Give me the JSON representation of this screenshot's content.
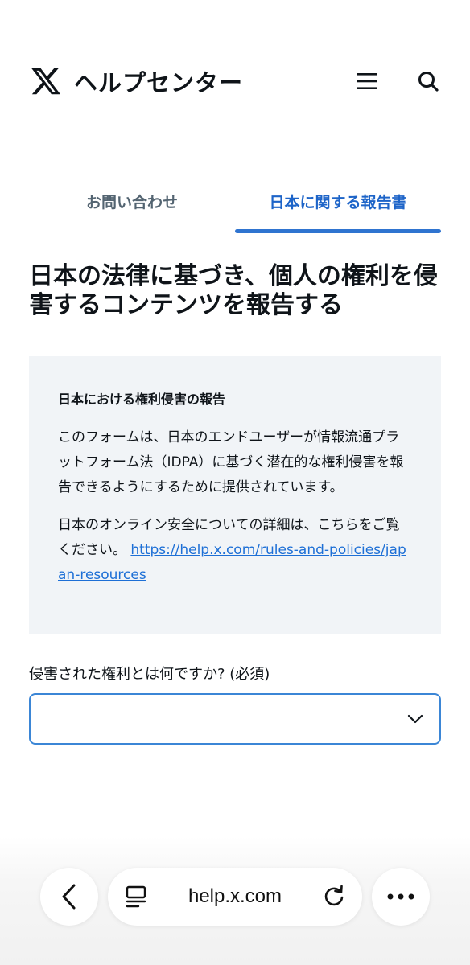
{
  "header": {
    "brand": "ヘルプセンター",
    "icons": {
      "logo": "x-logo-icon",
      "menu": "hamburger-menu-icon",
      "search": "search-icon"
    }
  },
  "tabs": [
    {
      "label": "お問い合わせ",
      "active": false
    },
    {
      "label": "日本に関する報告書",
      "active": true
    }
  ],
  "page_title": "日本の法律に基づき、個人の権利を侵害するコンテンツを報告する",
  "infobox": {
    "heading": "日本における権利侵害の報告",
    "paragraph1": "このフォームは、日本のエンドユーザーが情報流通プラットフォーム法（IDPA）に基づく潜在的な権利侵害を報告できるようにするために提供されています。",
    "paragraph2_prefix": "日本のオンライン安全についての詳細は、こちらをご覧ください。 ",
    "link_text": "https://help.x.com/rules-and-policies/japan-resources"
  },
  "form": {
    "field_label": "侵害された権利とは何ですか? (必須)",
    "select_value": ""
  },
  "browser": {
    "url": "help.x.com",
    "icons": {
      "back": "back-chevron-icon",
      "tabs": "reader-icon",
      "reload": "reload-icon",
      "more": "more-icon"
    }
  },
  "colors": {
    "accent": "#1d64c8",
    "link": "#1d6fd6",
    "infobox_bg": "#f1f4f7",
    "select_border": "#3b86d6"
  }
}
